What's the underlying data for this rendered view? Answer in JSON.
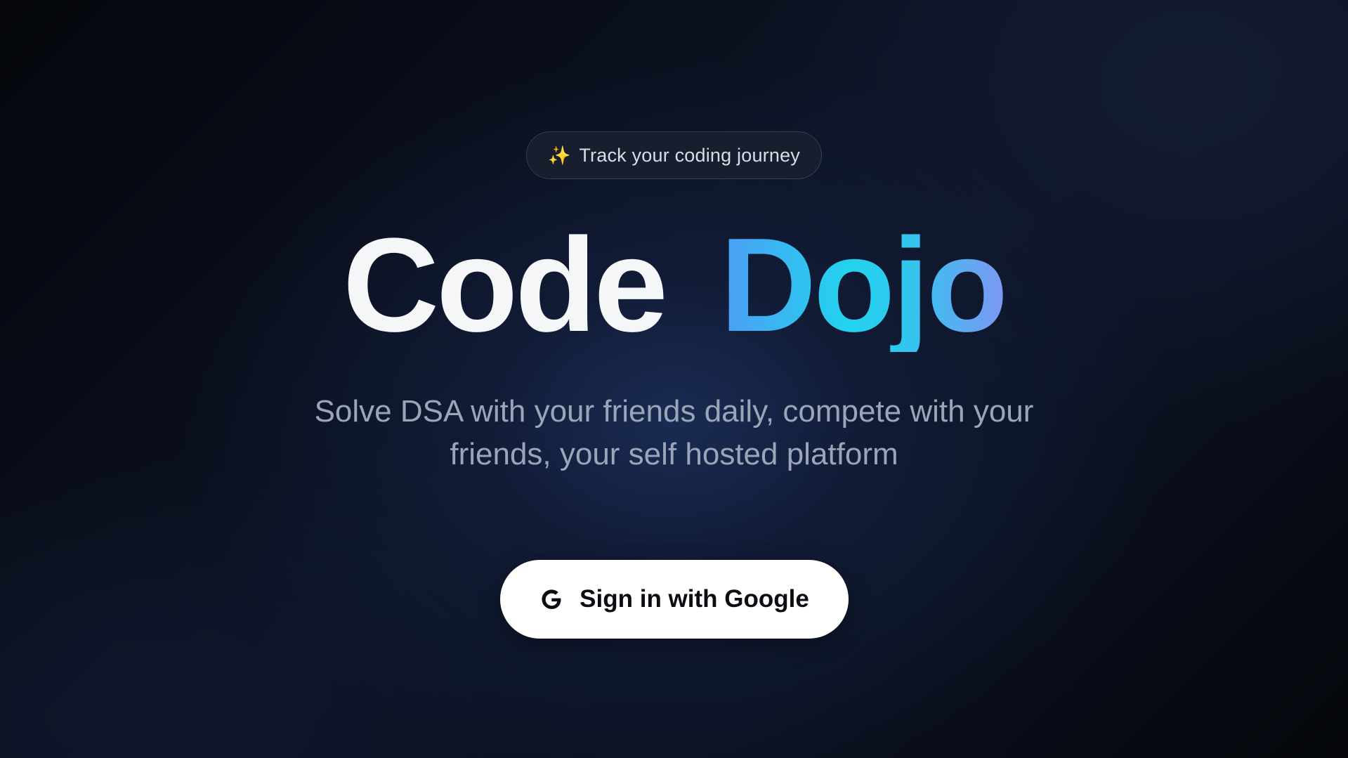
{
  "badge": {
    "icon": "sparkles-icon",
    "text": "Track your coding journey"
  },
  "title": {
    "part1": "Code",
    "part2": "Dojo"
  },
  "subtitle": "Solve DSA with your friends daily, compete with your friends, your self hosted platform",
  "signin": {
    "icon": "google-icon",
    "label": "Sign in with Google"
  },
  "colors": {
    "background": "#0b1020",
    "accent_gradient_start": "#4d9ef5",
    "accent_gradient_mid": "#22d3ee",
    "accent_gradient_end": "#7e96f4",
    "button_bg": "#ffffff"
  }
}
